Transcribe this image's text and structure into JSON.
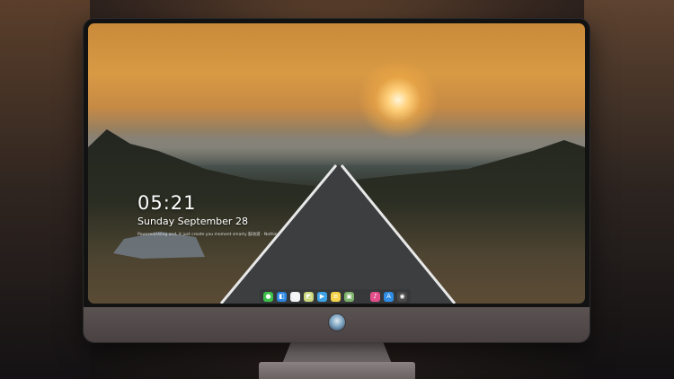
{
  "lock_screen": {
    "time": "05:21",
    "date": "Sunday September  28",
    "subtext": "Powered/Using and, it just create you moment smarty 鼓动道 · Nothing"
  },
  "dock": {
    "items": [
      {
        "name": "messages-icon",
        "color": "#3cc04a",
        "glyph": "●"
      },
      {
        "name": "finder-icon",
        "color": "#2b86e0",
        "glyph": "◧"
      },
      {
        "name": "clock-icon",
        "color": "#f2f2f2",
        "glyph": "◷"
      },
      {
        "name": "preview-icon",
        "color": "#c9d67a",
        "glyph": "◩"
      },
      {
        "name": "videos-icon",
        "color": "#3da3e6",
        "glyph": "▶"
      },
      {
        "name": "notes-icon",
        "color": "#f4d34a",
        "glyph": "≡"
      },
      {
        "name": "photos-icon",
        "color": "#7ab06a",
        "glyph": "▣"
      },
      {
        "name": "music-icon",
        "color": "#e34f8a",
        "glyph": "♪"
      },
      {
        "name": "app-store-icon",
        "color": "#2f8de6",
        "glyph": "A"
      },
      {
        "name": "camera-icon",
        "color": "#4a4a4a",
        "glyph": "◉"
      }
    ]
  },
  "monitor": {
    "logo": "monitor-logo"
  }
}
